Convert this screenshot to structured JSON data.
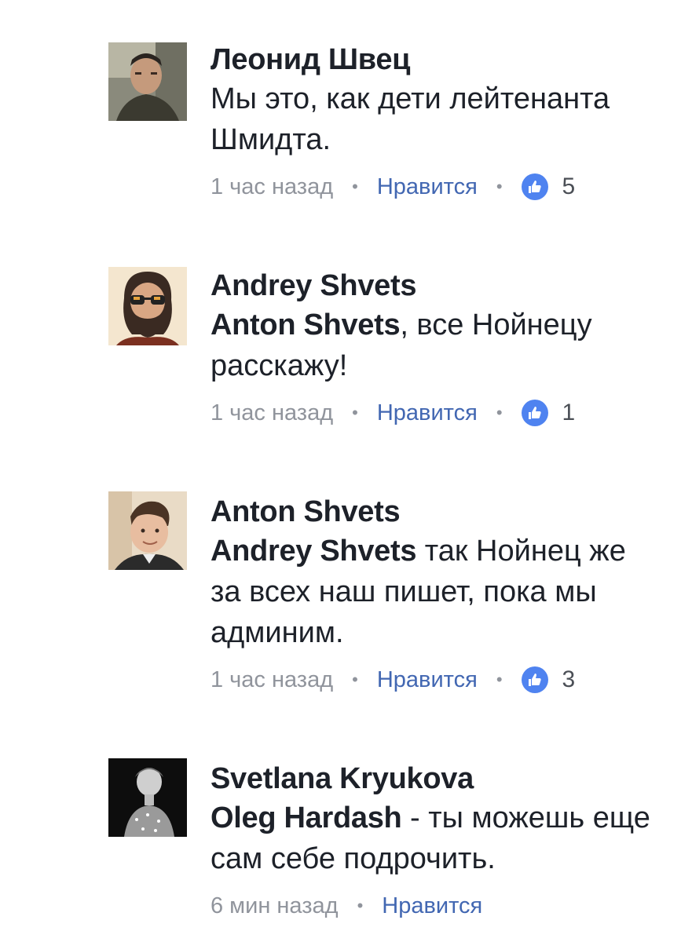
{
  "comments": [
    {
      "author": "Леонид Швец",
      "mention": "",
      "text": "Мы это, как дети лейтенанта Шмидта.",
      "time": "1 час назад",
      "like_label": "Нравится",
      "like_count": "5",
      "avatar_icon": "photo-avatar-man"
    },
    {
      "author": "Andrey Shvets",
      "mention": "Anton Shvets",
      "text": ", все Нойнецу расскажу!",
      "time": "1 час назад",
      "like_label": "Нравится",
      "like_count": "1",
      "avatar_icon": "cartoon-avatar-bearded-man-sunglasses"
    },
    {
      "author": "Anton Shvets",
      "mention": "Andrey Shvets",
      "text": " так Нойнец же за всех наш пишет, пока мы админим.",
      "time": "1 час назад",
      "like_label": "Нравится",
      "like_count": "3",
      "avatar_icon": "photo-avatar-young-man"
    },
    {
      "author": "Svetlana Kryukova",
      "mention": "Oleg Hardash",
      "text": " - ты можешь еще сам себе подрочить.",
      "time": "6 мин назад",
      "like_label": "Нравится",
      "like_count": "",
      "avatar_icon": "photo-avatar-woman-bw"
    }
  ],
  "separator": "•",
  "colors": {
    "author": "#1d2129",
    "meta": "#90949c",
    "like_link": "#4267b2",
    "like_badge": "#4f83f0"
  },
  "icons": {
    "like_badge": "thumbs-up-icon"
  }
}
